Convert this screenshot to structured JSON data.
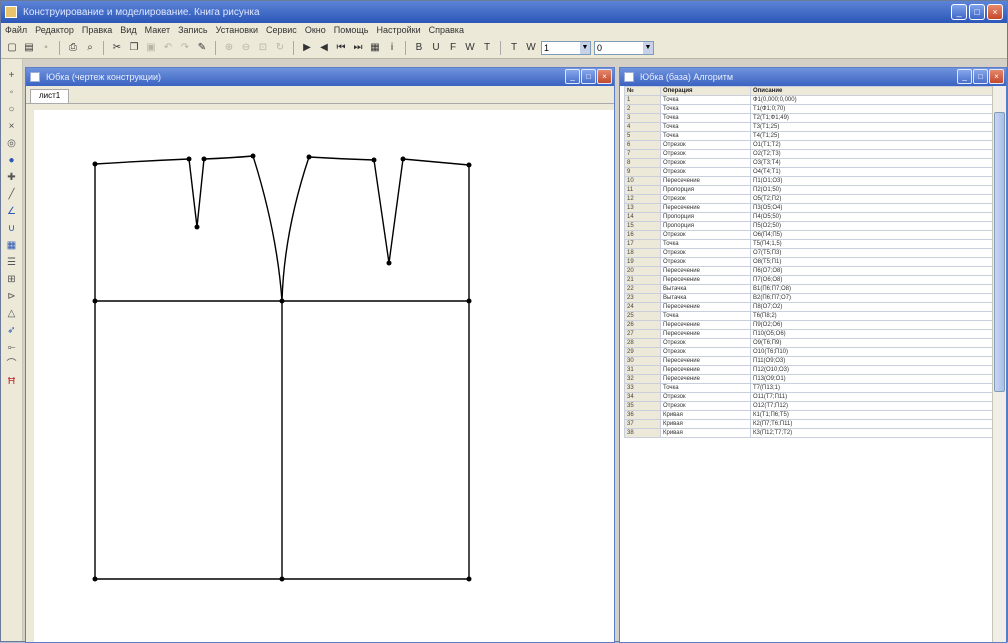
{
  "app": {
    "title": "Конструирование и моделирование. Книга рисунка",
    "menu": [
      "Файл",
      "Редактор",
      "Правка",
      "Вид",
      "Макет",
      "Запись",
      "Установки",
      "Сервис",
      "Окно",
      "Помощь",
      "Настройки",
      "Справка"
    ],
    "combo1": "1",
    "combo2": "0"
  },
  "draw_window": {
    "title": "Юбка (чертеж конструкции)",
    "tab": "лист1"
  },
  "table_window": {
    "title": "Юбка (база) Алгоритм",
    "headers": [
      "№",
      "Операция",
      "Описание"
    ],
    "rows": [
      [
        "1",
        "Точка",
        "Ф1(0,000;0,000)"
      ],
      [
        "2",
        "Точка",
        "Т1(Ф1;0;70)"
      ],
      [
        "3",
        "Точка",
        "Т2(Т1;Ф1;49)"
      ],
      [
        "4",
        "Точка",
        "Т3(Т1;25)"
      ],
      [
        "5",
        "Точка",
        "Т4(Т1;25)"
      ],
      [
        "6",
        "Отрезок",
        "О1(Т1;Т2)"
      ],
      [
        "7",
        "Отрезок",
        "О2(Т2;Т3)"
      ],
      [
        "8",
        "Отрезок",
        "О3(Т3;Т4)"
      ],
      [
        "9",
        "Отрезок",
        "О4(Т4;Т1)"
      ],
      [
        "10",
        "Пересечение",
        "П1(О1;О3)"
      ],
      [
        "11",
        "Пропорция",
        "П2(О1;50)"
      ],
      [
        "12",
        "Отрезок",
        "О5(Т2;П2)"
      ],
      [
        "13",
        "Пересечение",
        "П3(О5;О4)"
      ],
      [
        "14",
        "Пропорция",
        "П4(О5;50)"
      ],
      [
        "15",
        "Пропорция",
        "П5(О2;50)"
      ],
      [
        "16",
        "Отрезок",
        "О6(П4;П5)"
      ],
      [
        "17",
        "Точка",
        "Т5(П4;1,5)"
      ],
      [
        "18",
        "Отрезок",
        "О7(Т5;П3)"
      ],
      [
        "19",
        "Отрезок",
        "О8(Т5;П1)"
      ],
      [
        "20",
        "Пересечение",
        "П6(О7;О8)"
      ],
      [
        "21",
        "Пересечение",
        "П7(О6;О8)"
      ],
      [
        "22",
        "Вытачка",
        "В1(П6;П7;О8)"
      ],
      [
        "23",
        "Вытачка",
        "В2(П6;П7;О7)"
      ],
      [
        "24",
        "Пересечение",
        "П8(О7;О2)"
      ],
      [
        "25",
        "Точка",
        "Т6(П8;2)"
      ],
      [
        "26",
        "Пересечение",
        "П9(О2;О6)"
      ],
      [
        "27",
        "Пересечение",
        "П10(О5;О6)"
      ],
      [
        "28",
        "Отрезок",
        "О9(Т6;П9)"
      ],
      [
        "29",
        "Отрезок",
        "О10(Т6;П10)"
      ],
      [
        "30",
        "Пересечение",
        "П11(О9;О3)"
      ],
      [
        "31",
        "Пересечение",
        "П12(О10;О3)"
      ],
      [
        "32",
        "Пересечение",
        "П13(О9;О1)"
      ],
      [
        "33",
        "Точка",
        "Т7(П13;1)"
      ],
      [
        "34",
        "Отрезок",
        "О11(Т7;П11)"
      ],
      [
        "35",
        "Отрезок",
        "О12(Т7;П12)"
      ],
      [
        "36",
        "Кривая",
        "К1(Т1;П6;Т5)"
      ],
      [
        "37",
        "Кривая",
        "К2(П7;Т6;П11)"
      ],
      [
        "38",
        "Кривая",
        "К3(П12;Т7;Т2)"
      ]
    ]
  }
}
